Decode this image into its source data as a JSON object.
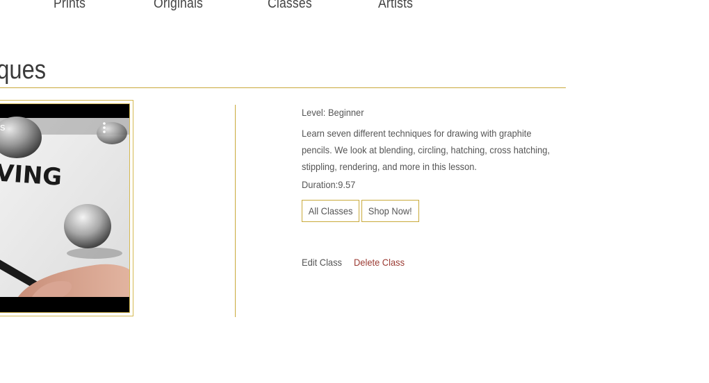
{
  "nav": {
    "items": [
      {
        "label": "Prints"
      },
      {
        "label": "Originals"
      },
      {
        "label": "Classes"
      },
      {
        "label": "Artists"
      }
    ]
  },
  "page": {
    "title": "iques"
  },
  "video": {
    "overlay_text_left": "s",
    "overlay_word": "VING",
    "icon": "more-vert-icon"
  },
  "class": {
    "level": "Level: Beginner",
    "description": "Learn seven different techniques for drawing with graphite pencils. We look at blending, circling, hatching, cross hatching, stippling, rendering, and more in this lesson.",
    "duration": "Duration:9.57"
  },
  "actions": {
    "all_classes": "All Classes",
    "shop_now": "Shop Now!",
    "edit_class": "Edit Class",
    "delete_class": "Delete Class"
  },
  "colors": {
    "accent_gold": "#c9a93a",
    "delete_red": "#9b3b33",
    "text": "#555555"
  }
}
